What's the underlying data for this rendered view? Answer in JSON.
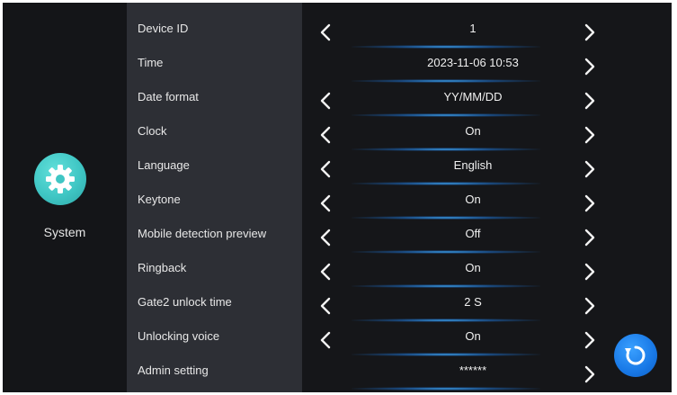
{
  "sidebar": {
    "system_label": "System",
    "icon": "gear-icon"
  },
  "settings": [
    {
      "label": "Device ID",
      "value": "1",
      "has_left": true,
      "has_right": true
    },
    {
      "label": "Time",
      "value": "2023-11-06  10:53",
      "has_left": false,
      "has_right": true
    },
    {
      "label": "Date format",
      "value": "YY/MM/DD",
      "has_left": true,
      "has_right": true
    },
    {
      "label": "Clock",
      "value": "On",
      "has_left": true,
      "has_right": true
    },
    {
      "label": "Language",
      "value": "English",
      "has_left": true,
      "has_right": true
    },
    {
      "label": "Keytone",
      "value": "On",
      "has_left": true,
      "has_right": true
    },
    {
      "label": "Mobile detection preview",
      "value": "Off",
      "has_left": true,
      "has_right": true
    },
    {
      "label": "Ringback",
      "value": "On",
      "has_left": true,
      "has_right": true
    },
    {
      "label": "Gate2 unlock time",
      "value": "2 S",
      "has_left": true,
      "has_right": true
    },
    {
      "label": "Unlocking voice",
      "value": "On",
      "has_left": true,
      "has_right": true
    },
    {
      "label": "Admin setting",
      "value": "******",
      "has_left": false,
      "has_right": true
    }
  ],
  "colors": {
    "accent_teal": "#3fc6c4",
    "accent_blue": "#1878e6",
    "underline_glow": "#46b4ff"
  },
  "floating_button": {
    "icon": "refresh-icon"
  }
}
